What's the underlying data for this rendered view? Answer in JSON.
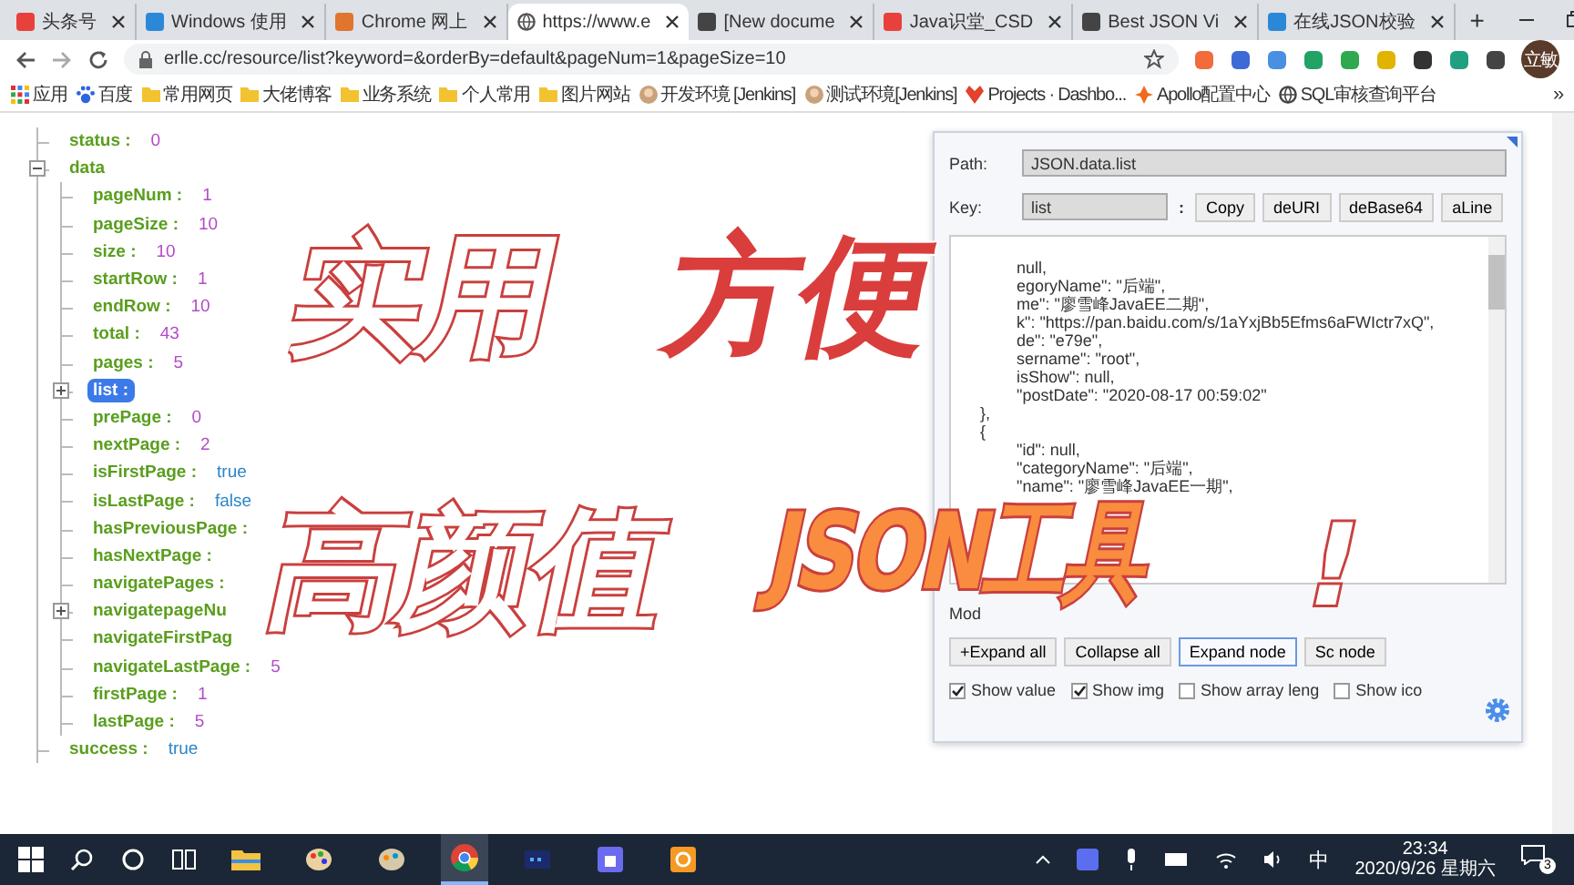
{
  "browser": {
    "tabs": [
      {
        "title": "头条号",
        "kind": "red",
        "selected": false
      },
      {
        "title": "Windows 使用",
        "kind": "blue",
        "selected": false
      },
      {
        "title": "Chrome 网上",
        "kind": "orange",
        "selected": false
      },
      {
        "title": "https://www.e",
        "kind": "globe",
        "selected": true
      },
      {
        "title": "[New docume",
        "kind": "dark",
        "selected": false
      },
      {
        "title": "Java识堂_CSD",
        "kind": "red",
        "selected": false
      },
      {
        "title": "Best JSON Vi",
        "kind": "dark",
        "selected": false
      },
      {
        "title": "在线JSON校验",
        "kind": "blue",
        "selected": false
      }
    ],
    "new_tab": "+",
    "url": "erlle.cc/resource/list?keyword=&orderBy=default&pageNum=1&pageSize=10",
    "avatar": "立敏",
    "bookmarks": [
      {
        "label": "应用",
        "kind": "apps"
      },
      {
        "label": "百度",
        "kind": "paw"
      },
      {
        "label": "常用网页",
        "kind": "folder"
      },
      {
        "label": "大佬博客",
        "kind": "folder"
      },
      {
        "label": "业务系统",
        "kind": "folder"
      },
      {
        "label": "个人常用",
        "kind": "folder"
      },
      {
        "label": "图片网站",
        "kind": "folder"
      },
      {
        "label": "开发环境 [Jenkins]",
        "kind": "jenkins"
      },
      {
        "label": "测试环境[Jenkins]",
        "kind": "jenkins"
      },
      {
        "label": "Projects · Dashbo...",
        "kind": "fox"
      },
      {
        "label": "Apollo配置中心",
        "kind": "apollo"
      },
      {
        "label": "SQL审核查询平台",
        "kind": "globe"
      }
    ],
    "more": "»"
  },
  "tree": [
    {
      "key": "status :",
      "value": "0",
      "kind": "number",
      "selected": false
    },
    {
      "key": "data",
      "selected": false,
      "expanded": true,
      "children": [
        {
          "key": "pageNum :",
          "value": "1",
          "kind": "number",
          "selected": false
        },
        {
          "key": "pageSize :",
          "value": "10",
          "kind": "number",
          "selected": false
        },
        {
          "key": "size :",
          "value": "10",
          "kind": "number",
          "selected": false
        },
        {
          "key": "startRow :",
          "value": "1",
          "kind": "number",
          "selected": false
        },
        {
          "key": "endRow :",
          "value": "10",
          "kind": "number",
          "selected": false
        },
        {
          "key": "total :",
          "value": "43",
          "kind": "number",
          "selected": false
        },
        {
          "key": "pages :",
          "value": "5",
          "kind": "number",
          "selected": false
        },
        {
          "key": "list :",
          "selected": true,
          "expanded": false
        },
        {
          "key": "prePage :",
          "value": "0",
          "kind": "number",
          "selected": false
        },
        {
          "key": "nextPage :",
          "value": "2",
          "kind": "number",
          "selected": false
        },
        {
          "key": "isFirstPage :",
          "value": "true",
          "kind": "boolean",
          "selected": false
        },
        {
          "key": "isLastPage :",
          "value": "false",
          "kind": "boolean",
          "selected": false
        },
        {
          "key": "hasPreviousPage :",
          "selected": false
        },
        {
          "key": "hasNextPage :",
          "selected": false
        },
        {
          "key": "navigatePages :",
          "selected": false
        },
        {
          "key": "navigatepageNu",
          "selected": false,
          "expanded": false
        },
        {
          "key": "navigateFirstPag",
          "selected": false
        },
        {
          "key": "navigateLastPage :",
          "value": "5",
          "kind": "number",
          "selected": false
        },
        {
          "key": "firstPage :",
          "value": "1",
          "kind": "number",
          "selected": false
        },
        {
          "key": "lastPage :",
          "value": "5",
          "kind": "number",
          "selected": false
        }
      ]
    },
    {
      "key": "success :",
      "value": "true",
      "kind": "boolean",
      "selected": false
    }
  ],
  "panel": {
    "path_label": "Path:",
    "path": "JSON.data.list",
    "key_label": "Key:",
    "key": "list",
    "colon": ":",
    "tools": [
      "Copy",
      "deURI",
      "deBase64",
      "aLine"
    ],
    "text_lines": [
      {
        "text": "null,",
        "kind": "inner"
      },
      {
        "text": "egoryName\": \"后端\",",
        "kind": "inner"
      },
      {
        "text": "me\": \"廖雪峰JavaEE二期\",",
        "kind": "inner"
      },
      {
        "text": "k\": \"https://pan.baidu.com/s/1aYxjBb5Efms6aFWIctr7xQ\",",
        "kind": "inner"
      },
      {
        "text": "de\": \"e79e\",",
        "kind": "inner"
      },
      {
        "text": "sername\": \"root\",",
        "kind": "inner"
      },
      {
        "text": "isShow\": null,",
        "kind": "inner"
      },
      {
        "text": "\"postDate\": \"2020-08-17 00:59:02\"",
        "kind": "inner"
      },
      {
        "text": "},",
        "kind": "outer"
      },
      {
        "text": "{",
        "kind": "outer"
      },
      {
        "text": "\"id\": null,",
        "kind": "inner"
      },
      {
        "text": "\"categoryName\": \"后端\",",
        "kind": "inner"
      },
      {
        "text": "\"name\": \"廖雪峰JavaEE一期\",",
        "kind": "inner"
      }
    ],
    "mode_label": "Mod",
    "buttons": [
      {
        "label": "+Expand all",
        "selected": false
      },
      {
        "label": "Collapse all",
        "selected": false
      },
      {
        "label": "Expand node",
        "selected": true
      },
      {
        "label": "Sc node",
        "selected": false
      }
    ],
    "options": [
      {
        "label": "Show value",
        "checked": true
      },
      {
        "label": "Show img",
        "checked": true
      },
      {
        "label": "Show array leng",
        "checked": false
      },
      {
        "label": "Show ico",
        "checked": false
      }
    ]
  },
  "overlay": [
    {
      "text": "实用",
      "kind": "white"
    },
    {
      "text": "方便",
      "kind": "red"
    },
    {
      "text": "高颜值",
      "kind": "white"
    },
    {
      "text": "JSON工具",
      "kind": "orange"
    },
    {
      "text": "!",
      "kind": "white"
    }
  ],
  "taskbar": {
    "apps": [
      {
        "kind": "explorer",
        "selected": false
      },
      {
        "kind": "paint",
        "selected": false
      },
      {
        "kind": "palette",
        "selected": false
      },
      {
        "kind": "chrome",
        "selected": true
      },
      {
        "kind": "terminal",
        "selected": false
      },
      {
        "kind": "store",
        "selected": false
      },
      {
        "kind": "orange",
        "selected": false
      }
    ],
    "ime": "中",
    "time": "23:34",
    "date": "2020/9/26 星期六",
    "notifications": "3"
  }
}
